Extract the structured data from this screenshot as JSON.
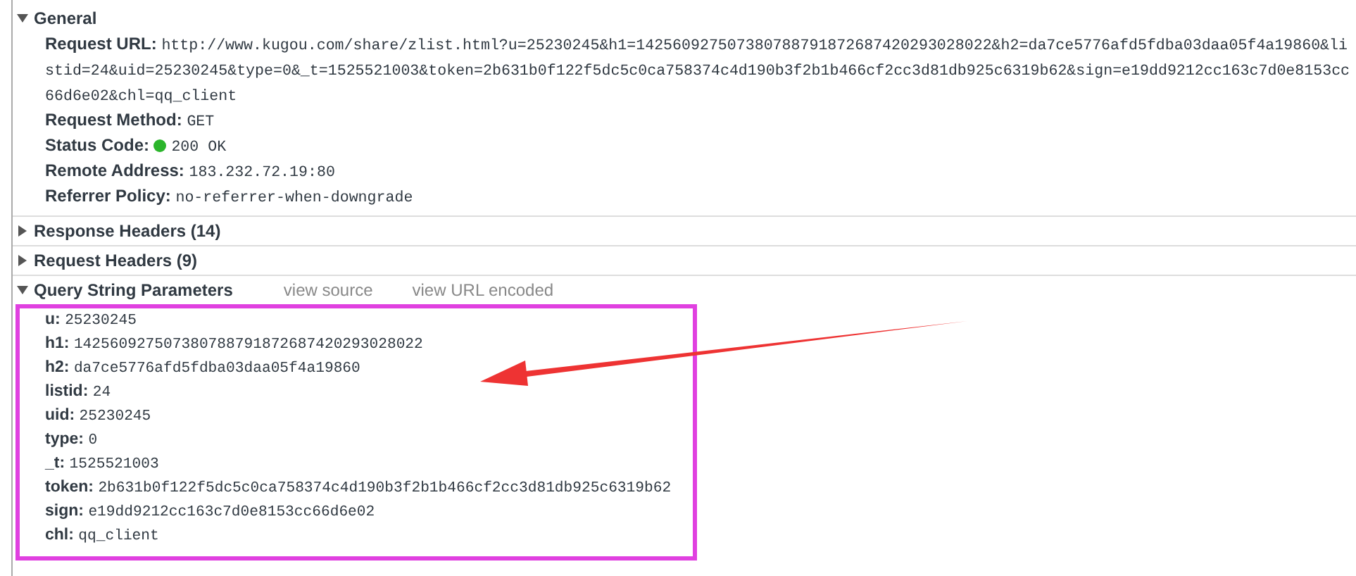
{
  "sections": [
    {
      "title": "General",
      "expanded": true,
      "fields": [
        {
          "label": "Request URL:",
          "value": "http://www.kugou.com/share/zlist.html?u=25230245&h1=142560927507380788791872687420293028022&h2=da7ce5776afd5fdba03daa05f4a19860&listid=24&uid=25230245&type=0&_t=1525521003&token=2b631b0f122f5dc5c0ca758374c4d190b3f2b1b466cf2cc3d81db925c6319b62&sign=e19dd9212cc163c7d0e8153cc66d6e02&chl=qq_client"
        },
        {
          "label": "Request Method:",
          "value": "GET"
        },
        {
          "label": "Status Code:",
          "value": "200 OK",
          "kind": "status"
        },
        {
          "label": "Remote Address:",
          "value": "183.232.72.19:80"
        },
        {
          "label": "Referrer Policy:",
          "value": "no-referrer-when-downgrade"
        }
      ]
    },
    {
      "title": "Response Headers (14)",
      "expanded": false
    },
    {
      "title": "Request Headers (9)",
      "expanded": false
    },
    {
      "title": "Query String Parameters",
      "expanded": true,
      "links": [
        "view source",
        "view URL encoded"
      ],
      "highlighted": true,
      "fields": [
        {
          "label": "u:",
          "value": "25230245"
        },
        {
          "label": "h1:",
          "value": "142560927507380788791872687420293028022"
        },
        {
          "label": "h2:",
          "value": "da7ce5776afd5fdba03daa05f4a19860"
        },
        {
          "label": "listid:",
          "value": "24"
        },
        {
          "label": "uid:",
          "value": "25230245"
        },
        {
          "label": "type:",
          "value": "0"
        },
        {
          "label": "_t:",
          "value": "1525521003"
        },
        {
          "label": "token:",
          "value": "2b631b0f122f5dc5c0ca758374c4d190b3f2b1b466cf2cc3d81db925c6319b62"
        },
        {
          "label": "sign:",
          "value": "e19dd9212cc163c7d0e8153cc66d6e02"
        },
        {
          "label": "chl:",
          "value": "qq_client"
        }
      ]
    }
  ],
  "annotation_arrow": true
}
